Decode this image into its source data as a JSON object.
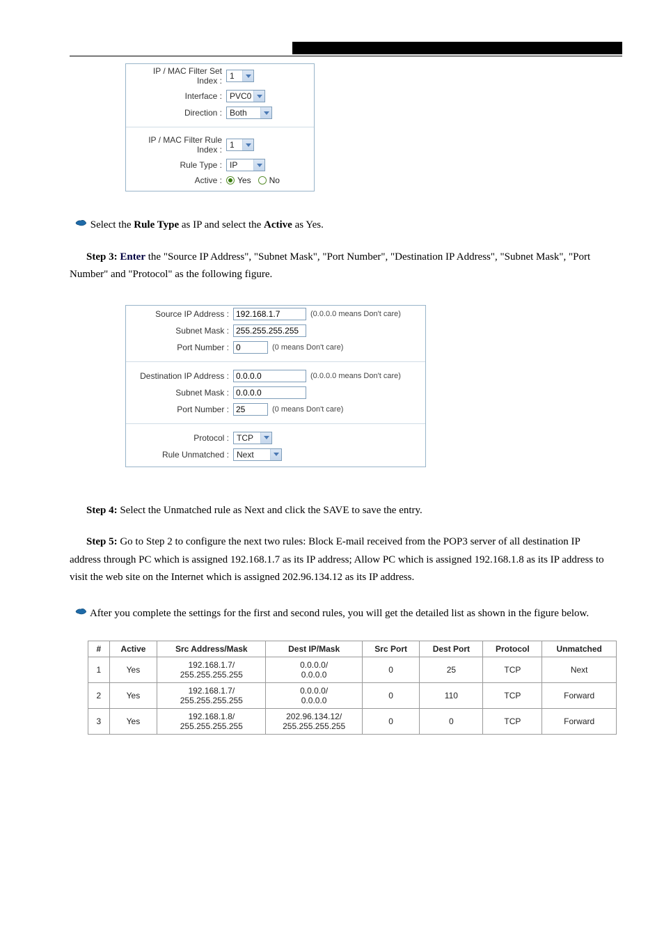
{
  "panel1": {
    "labels": {
      "set_index": "IP / MAC Filter Set Index :",
      "interface": "Interface :",
      "direction": "Direction :",
      "rule_index": "IP / MAC Filter Rule Index :",
      "rule_type": "Rule Type :",
      "active": "Active :"
    },
    "values": {
      "set_index": "1",
      "interface": "PVC0",
      "direction": "Both",
      "rule_index": "1",
      "rule_type": "IP",
      "active_yes": "Yes",
      "active_no": "No"
    }
  },
  "step2_intro": "Select the ",
  "step2_rest": " as IP and select the ",
  "step2_rest2": " as Yes.",
  "step2_rt": "Rule Type",
  "step2_active": "Active",
  "step3": {
    "label": "Step 3:",
    "lead_word": "Enter",
    "rest": " the \"Source IP Address\", \"Subnet Mask\", \"Port Number\", \"Destination IP Address\", \"Subnet Mask\", \"Port Number\" and \"Protocol\" as the following figure."
  },
  "panel3": {
    "labels": {
      "src_ip": "Source IP Address :",
      "subnet": "Subnet Mask :",
      "port": "Port Number :",
      "dest_ip": "Destination IP Address :",
      "protocol": "Protocol :",
      "rule_unmatched": "Rule Unmatched :"
    },
    "values": {
      "src_ip": "192.168.1.7",
      "src_mask": "255.255.255.255",
      "src_port": "0",
      "dest_ip": "0.0.0.0",
      "dest_mask": "0.0.0.0",
      "dest_port": "25",
      "protocol": "TCP",
      "rule_unmatched": "Next"
    },
    "hints": {
      "ip": "(0.0.0.0 means Don't care)",
      "port": "(0 means Don't care)"
    }
  },
  "step4": {
    "label": "Step 4:",
    "text": " Select the Unmatched rule as Next and click the SAVE to save the entry."
  },
  "step5": {
    "label": "Step 5:",
    "text": " Go to Step 2 to configure the next two rules: Block E-mail received from the POP3 server of all destination IP address through PC which is assigned 192.168.1.7 as its IP address; Allow PC which is assigned 192.168.1.8 as its IP address to visit the web site on the Internet which is assigned 202.96.134.12 as its IP address."
  },
  "step2_line2": "After you complete the settings for the first and second rules, you will get the detailed list as shown in the figure below.",
  "table": {
    "headers": {
      "num": "#",
      "active": "Active",
      "src": "Src Address/Mask",
      "dest": "Dest IP/Mask",
      "src_port": "Src Port",
      "dest_port": "Dest Port",
      "protocol": "Protocol",
      "unmatched": "Unmatched"
    },
    "rows": [
      {
        "num": "1",
        "active": "Yes",
        "src1": "192.168.1.7/",
        "src2": "255.255.255.255",
        "dest1": "0.0.0.0/",
        "dest2": "0.0.0.0",
        "src_port": "0",
        "dest_port": "25",
        "protocol": "TCP",
        "unmatched": "Next"
      },
      {
        "num": "2",
        "active": "Yes",
        "src1": "192.168.1.7/",
        "src2": "255.255.255.255",
        "dest1": "0.0.0.0/",
        "dest2": "0.0.0.0",
        "src_port": "0",
        "dest_port": "110",
        "protocol": "TCP",
        "unmatched": "Forward"
      },
      {
        "num": "3",
        "active": "Yes",
        "src1": "192.168.1.8/",
        "src2": "255.255.255.255",
        "dest1": "202.96.134.12/",
        "dest2": "255.255.255.255",
        "src_port": "0",
        "dest_port": "0",
        "protocol": "TCP",
        "unmatched": "Forward"
      }
    ]
  }
}
